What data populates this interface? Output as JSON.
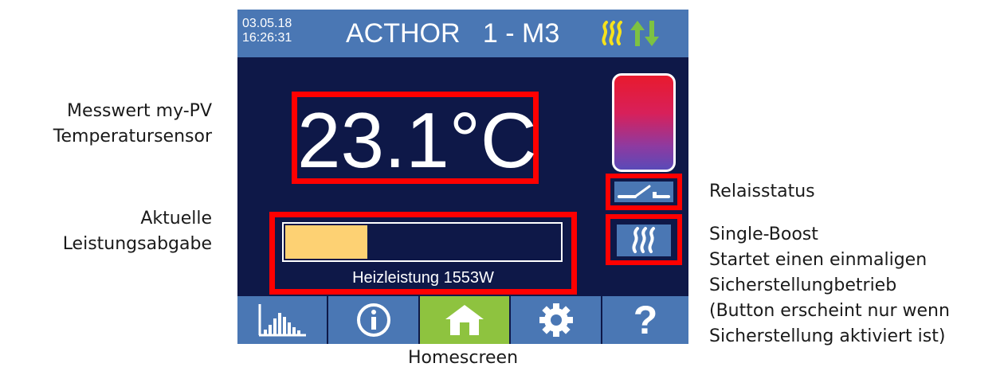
{
  "annotations": {
    "sensor_line1": "Messwert my-PV",
    "sensor_line2": "Temperatursensor",
    "power_line1": "Aktuelle",
    "power_line2": "Leistungsabgabe",
    "relay": "Relaisstatus",
    "boost_title": "Single-Boost",
    "boost_line1": "Startet einen einmaligen",
    "boost_line2": "Sicherstellungbetrieb",
    "boost_line3": "(Button erscheint nur wenn",
    "boost_line4": "Sicherstellung aktiviert ist)",
    "caption": "Homescreen"
  },
  "device": {
    "date": "03.05.18",
    "time": "16:26:31",
    "title": "ACTHOR   1 - M3",
    "temperature": "23.1°C",
    "power_label": "Heizleistung 1553W",
    "power_fraction": 0.3,
    "status_icons": [
      "heating-icon",
      "arrows-up-down-icon"
    ],
    "relay_icon": "relay-switch-icon",
    "boost_icon": "heating-icon"
  },
  "nav": {
    "items": [
      {
        "name": "statistics",
        "icon": "bar-chart-icon"
      },
      {
        "name": "info",
        "icon": "info-icon"
      },
      {
        "name": "home",
        "icon": "home-icon",
        "active": true
      },
      {
        "name": "settings",
        "icon": "gear-icon"
      },
      {
        "name": "help",
        "icon": "help-icon",
        "glyph": "?"
      }
    ]
  },
  "colors": {
    "screen_bg": "#0e1848",
    "bar_blue": "#4a77b4",
    "active_green": "#8ec33f",
    "power_fill": "#fdd173",
    "highlight_red": "#ff0000",
    "heat_yellow": "#f6e21c",
    "arrow_green": "#7dc242"
  }
}
